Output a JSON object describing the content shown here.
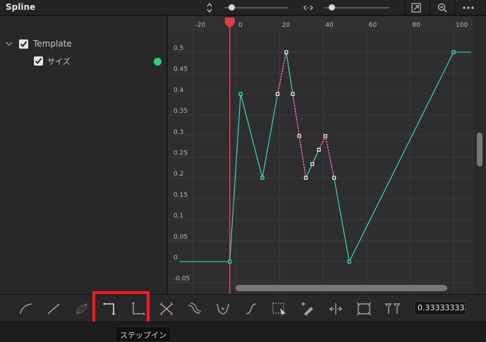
{
  "header": {
    "title": "Spline",
    "icons": [
      "sort-icon",
      "zoom-fit-icon",
      "expand-icon",
      "zoom-icon",
      "more-icon"
    ],
    "vertical_zoom_slider": 0.15,
    "horizontal_zoom_slider": 0.15
  },
  "tree": {
    "group_label": "Template",
    "group_checked": true,
    "item_label": "サイズ",
    "item_checked": true,
    "item_color": "#2fd36a"
  },
  "graph": {
    "x_ticks": [
      "-20",
      "0",
      "20",
      "40",
      "60",
      "80",
      "100"
    ],
    "y_ticks": [
      "0.5",
      "0.45",
      "0.4",
      "0.35",
      "0.3",
      "0.25",
      "0.2",
      "0.15",
      "0.1",
      "0.05",
      "0",
      "-0.05"
    ],
    "curve_color": "#3ee6b8",
    "selected_color": "#d0206e",
    "playhead_frame": -3,
    "playhead_color": "#e04040",
    "keyframes": [
      {
        "x": -26,
        "y": 0
      },
      {
        "x": -3,
        "y": 0
      },
      {
        "x": 2,
        "y": 0.4
      },
      {
        "x": 12,
        "y": 0.2
      },
      {
        "x": 19,
        "y": 0.4
      },
      {
        "x": 23,
        "y": 0.5
      },
      {
        "x": 26,
        "y": 0.4
      },
      {
        "x": 29,
        "y": 0.3
      },
      {
        "x": 32,
        "y": 0.2
      },
      {
        "x": 35,
        "y": 0.233
      },
      {
        "x": 38,
        "y": 0.267
      },
      {
        "x": 41,
        "y": 0.3
      },
      {
        "x": 45,
        "y": 0.2
      },
      {
        "x": 52,
        "y": 0
      },
      {
        "x": 100,
        "y": 0.5
      },
      {
        "x": 108,
        "y": 0.5
      }
    ]
  },
  "toolbar": {
    "tools": [
      "smooth-curve-icon",
      "linear-icon",
      "invert-icon",
      "step-in-icon",
      "step-out-icon",
      "reverse-icon",
      "loop-icon",
      "ping-pong-icon",
      "ease-icon",
      "select-rect-icon",
      "pen-icon",
      "time-stretch-icon",
      "fit-frame-icon",
      "filter-icon"
    ],
    "value": "0.333333333"
  },
  "tooltip": "ステップイン"
}
